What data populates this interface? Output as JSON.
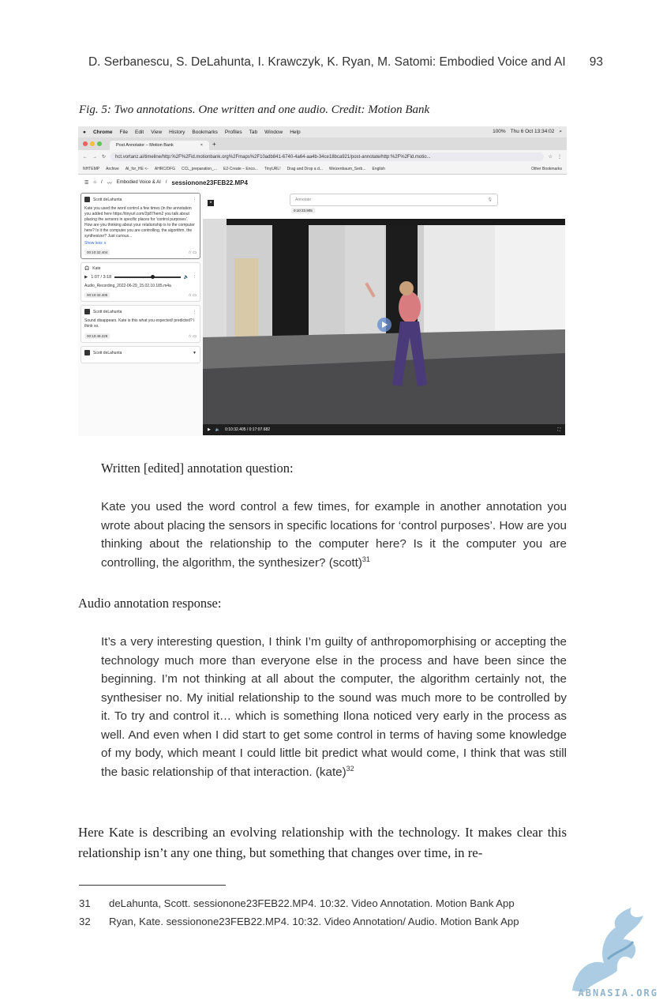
{
  "header": {
    "authors_title": "D. Serbanescu, S. DeLahunta, I. Krawczyk, K. Ryan, M. Satomi: Embodied Voice and AI",
    "page_number": "93"
  },
  "figure": {
    "caption": "Fig. 5: Two annotations. One written and one audio. Credit: Motion Bank",
    "menubar": {
      "app": "Chrome",
      "items": [
        "File",
        "Edit",
        "View",
        "History",
        "Bookmarks",
        "Profiles",
        "Tab",
        "Window",
        "Help"
      ],
      "clock": "Thu 6 Oct 13:34:02",
      "battery": "100%"
    },
    "tab_title": "Post Annotator – Motion Bank",
    "url": "hct.vortanz.ai/timeline/http:%2F%2Fid.motionbank.org%2Fmaps%2F10adb841-6740-4a64-aa4b-34ce18bca921/post-annotate/http:%2F%2Fid.motio...",
    "bookmarks": [
      "NHTEMP",
      "Archive",
      "AI_for_HE <-",
      "AHRC/DFG",
      "CCL_preparation_...",
      "E2-Create – Enco...",
      "TinyURL!",
      "Drag and Drop a d...",
      "Weizenbaum_Serb...",
      "English",
      "Other Bookmarks"
    ],
    "breadcrumb": "Embodied Voice & AI",
    "session_title": "sessionone23FEB22.MP4",
    "annotate_placeholder": "Annotate",
    "annotate_time": "0:10:33.905",
    "cards": [
      {
        "author": "Scott deLahunta",
        "text": "Kate you used the word control a few times (in the annotation you added here https://tinyurl.com/2p87hem2 you talk about placing the sensors in specific places for 'control purposes'. How are you thinking about your relationship is to the computer here? Is it the computer you are controlling, the algorithm, the synthesizer? Just curious...",
        "more": "Show less ∧",
        "time": "00:10:32.404"
      },
      {
        "author": "Kate",
        "audio_time": "1:07 / 3:18",
        "file": "Audio_Recording_2022-06-29_15.02.10.185.m4a",
        "time": "00:10:32.405"
      },
      {
        "author": "Scott deLahunta",
        "text": "Sound disappears. Kate is this what you expected/ predicted? I think so.",
        "time": "00:10:48.229"
      },
      {
        "author": "Scott deLahunta"
      }
    ],
    "video_time": "0:10:32.405 / 0:17:07.682"
  },
  "written_intro": "Written [edited] annotation question:",
  "question": "Kate you used the word control a few times, for example in another annotation you wrote about placing the sensors in specific locations for ‘control purposes’. How are you thinking about the relationship to the computer here? Is it the computer you are controlling, the algorithm, the synthesizer? (scott)",
  "question_ref": "31",
  "audio_intro": "Audio annotation response:",
  "answer": "It’s a very interesting question, I think I’m guilty of anthropomorphising or accepting the technology much more than everyone else in the process and have been since the beginning. I’m not thinking at all about the computer, the algorithm certainly not, the synthesiser no. My initial relationship to the sound was much more to be controlled by it. To try and control it… which is something Ilona noticed very early in the process as well. And even when I did start to get some control in terms of having some knowledge of my body, which meant I could little bit predict what would come, I think that was still the basic relationship of that interaction. (kate)",
  "answer_ref": "32",
  "paragraph": "Here Kate is describing an evolving relationship with the technology. It makes clear this relationship isn’t any one thing, but something that changes over time, in re-",
  "footnotes": [
    {
      "num": "31",
      "text": "deLahunta, Scott. sessionone23FEB22.MP4. 10:32. Video Annotation. Motion Bank App"
    },
    {
      "num": "32",
      "text": "Ryan, Kate. sessionone23FEB22.MP4. 10:32. Video Annotation/ Audio. Motion Bank App"
    }
  ],
  "watermark": "ABNASIA.ORG"
}
